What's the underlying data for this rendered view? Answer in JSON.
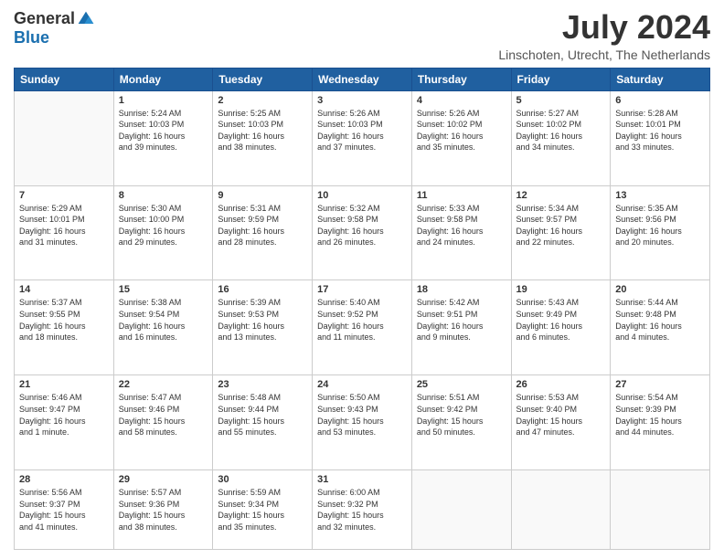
{
  "header": {
    "logo_general": "General",
    "logo_blue": "Blue",
    "month_year": "July 2024",
    "location": "Linschoten, Utrecht, The Netherlands"
  },
  "calendar": {
    "days_of_week": [
      "Sunday",
      "Monday",
      "Tuesday",
      "Wednesday",
      "Thursday",
      "Friday",
      "Saturday"
    ],
    "weeks": [
      [
        {
          "day": "",
          "info": ""
        },
        {
          "day": "1",
          "info": "Sunrise: 5:24 AM\nSunset: 10:03 PM\nDaylight: 16 hours\nand 39 minutes."
        },
        {
          "day": "2",
          "info": "Sunrise: 5:25 AM\nSunset: 10:03 PM\nDaylight: 16 hours\nand 38 minutes."
        },
        {
          "day": "3",
          "info": "Sunrise: 5:26 AM\nSunset: 10:03 PM\nDaylight: 16 hours\nand 37 minutes."
        },
        {
          "day": "4",
          "info": "Sunrise: 5:26 AM\nSunset: 10:02 PM\nDaylight: 16 hours\nand 35 minutes."
        },
        {
          "day": "5",
          "info": "Sunrise: 5:27 AM\nSunset: 10:02 PM\nDaylight: 16 hours\nand 34 minutes."
        },
        {
          "day": "6",
          "info": "Sunrise: 5:28 AM\nSunset: 10:01 PM\nDaylight: 16 hours\nand 33 minutes."
        }
      ],
      [
        {
          "day": "7",
          "info": "Sunrise: 5:29 AM\nSunset: 10:01 PM\nDaylight: 16 hours\nand 31 minutes."
        },
        {
          "day": "8",
          "info": "Sunrise: 5:30 AM\nSunset: 10:00 PM\nDaylight: 16 hours\nand 29 minutes."
        },
        {
          "day": "9",
          "info": "Sunrise: 5:31 AM\nSunset: 9:59 PM\nDaylight: 16 hours\nand 28 minutes."
        },
        {
          "day": "10",
          "info": "Sunrise: 5:32 AM\nSunset: 9:58 PM\nDaylight: 16 hours\nand 26 minutes."
        },
        {
          "day": "11",
          "info": "Sunrise: 5:33 AM\nSunset: 9:58 PM\nDaylight: 16 hours\nand 24 minutes."
        },
        {
          "day": "12",
          "info": "Sunrise: 5:34 AM\nSunset: 9:57 PM\nDaylight: 16 hours\nand 22 minutes."
        },
        {
          "day": "13",
          "info": "Sunrise: 5:35 AM\nSunset: 9:56 PM\nDaylight: 16 hours\nand 20 minutes."
        }
      ],
      [
        {
          "day": "14",
          "info": "Sunrise: 5:37 AM\nSunset: 9:55 PM\nDaylight: 16 hours\nand 18 minutes."
        },
        {
          "day": "15",
          "info": "Sunrise: 5:38 AM\nSunset: 9:54 PM\nDaylight: 16 hours\nand 16 minutes."
        },
        {
          "day": "16",
          "info": "Sunrise: 5:39 AM\nSunset: 9:53 PM\nDaylight: 16 hours\nand 13 minutes."
        },
        {
          "day": "17",
          "info": "Sunrise: 5:40 AM\nSunset: 9:52 PM\nDaylight: 16 hours\nand 11 minutes."
        },
        {
          "day": "18",
          "info": "Sunrise: 5:42 AM\nSunset: 9:51 PM\nDaylight: 16 hours\nand 9 minutes."
        },
        {
          "day": "19",
          "info": "Sunrise: 5:43 AM\nSunset: 9:49 PM\nDaylight: 16 hours\nand 6 minutes."
        },
        {
          "day": "20",
          "info": "Sunrise: 5:44 AM\nSunset: 9:48 PM\nDaylight: 16 hours\nand 4 minutes."
        }
      ],
      [
        {
          "day": "21",
          "info": "Sunrise: 5:46 AM\nSunset: 9:47 PM\nDaylight: 16 hours\nand 1 minute."
        },
        {
          "day": "22",
          "info": "Sunrise: 5:47 AM\nSunset: 9:46 PM\nDaylight: 15 hours\nand 58 minutes."
        },
        {
          "day": "23",
          "info": "Sunrise: 5:48 AM\nSunset: 9:44 PM\nDaylight: 15 hours\nand 55 minutes."
        },
        {
          "day": "24",
          "info": "Sunrise: 5:50 AM\nSunset: 9:43 PM\nDaylight: 15 hours\nand 53 minutes."
        },
        {
          "day": "25",
          "info": "Sunrise: 5:51 AM\nSunset: 9:42 PM\nDaylight: 15 hours\nand 50 minutes."
        },
        {
          "day": "26",
          "info": "Sunrise: 5:53 AM\nSunset: 9:40 PM\nDaylight: 15 hours\nand 47 minutes."
        },
        {
          "day": "27",
          "info": "Sunrise: 5:54 AM\nSunset: 9:39 PM\nDaylight: 15 hours\nand 44 minutes."
        }
      ],
      [
        {
          "day": "28",
          "info": "Sunrise: 5:56 AM\nSunset: 9:37 PM\nDaylight: 15 hours\nand 41 minutes."
        },
        {
          "day": "29",
          "info": "Sunrise: 5:57 AM\nSunset: 9:36 PM\nDaylight: 15 hours\nand 38 minutes."
        },
        {
          "day": "30",
          "info": "Sunrise: 5:59 AM\nSunset: 9:34 PM\nDaylight: 15 hours\nand 35 minutes."
        },
        {
          "day": "31",
          "info": "Sunrise: 6:00 AM\nSunset: 9:32 PM\nDaylight: 15 hours\nand 32 minutes."
        },
        {
          "day": "",
          "info": ""
        },
        {
          "day": "",
          "info": ""
        },
        {
          "day": "",
          "info": ""
        }
      ]
    ]
  }
}
